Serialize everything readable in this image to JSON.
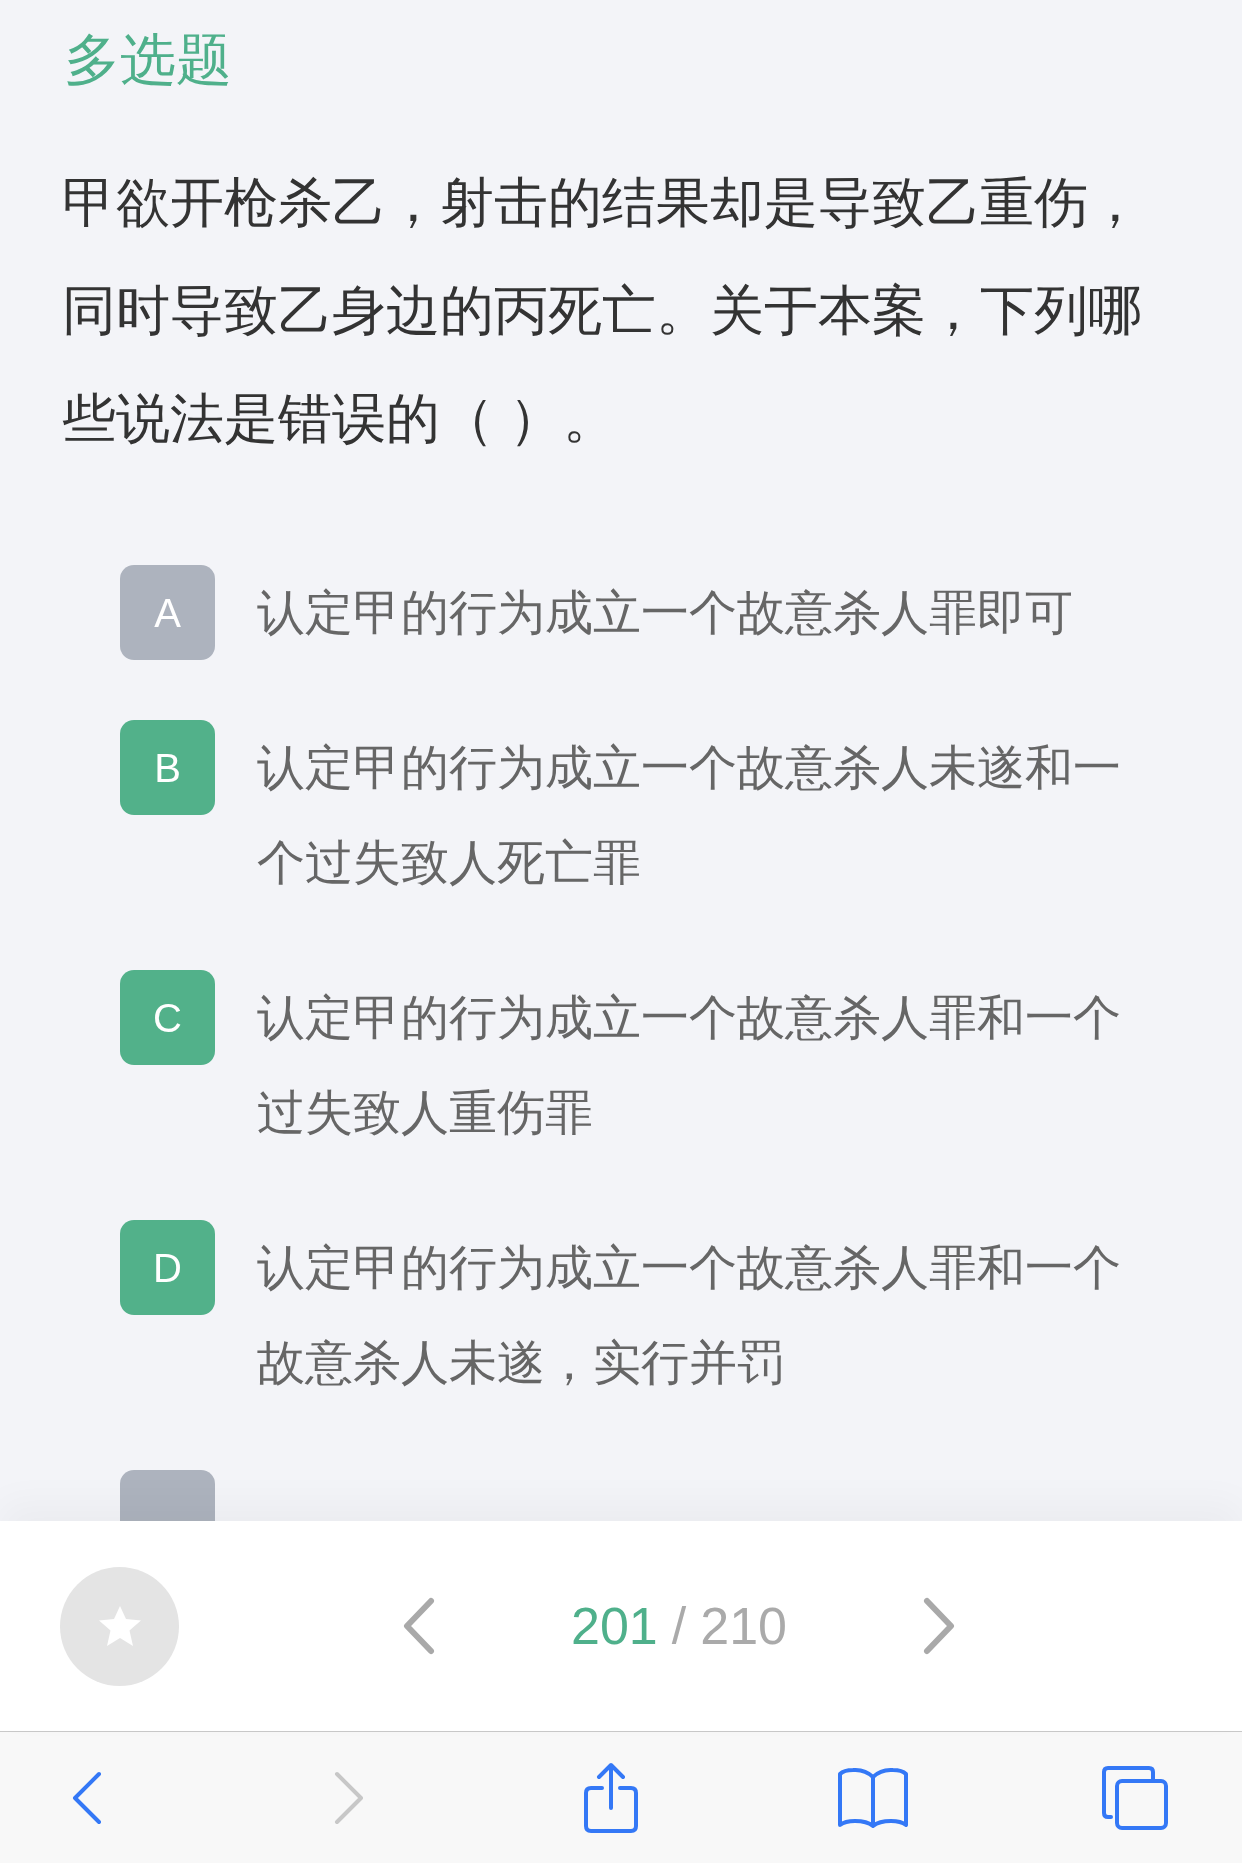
{
  "question": {
    "type_label": "多选题",
    "text": "甲欲开枪杀乙，射击的结果却是导致乙重伤，同时导致乙身边的丙死亡。关于本案，下列哪些说法是错误的（ ）。"
  },
  "options": [
    {
      "letter": "A",
      "text": "认定甲的行为成立一个故意杀人罪即可",
      "selected": false
    },
    {
      "letter": "B",
      "text": "认定甲的行为成立一个故意杀人未遂和一个过失致人死亡罪",
      "selected": true
    },
    {
      "letter": "C",
      "text": "认定甲的行为成立一个故意杀人罪和一个过失致人重伤罪",
      "selected": true
    },
    {
      "letter": "D",
      "text": "认定甲的行为成立一个故意杀人罪和一个故意杀人未遂，实行并罚",
      "selected": true
    },
    {
      "selected": false
    }
  ],
  "favorite": {
    "starred": false
  },
  "pager": {
    "current": "201",
    "separator": "/",
    "total": "210"
  },
  "browser_toolbar": {
    "back": {
      "disabled": false
    },
    "forward": {
      "disabled": true
    }
  }
}
